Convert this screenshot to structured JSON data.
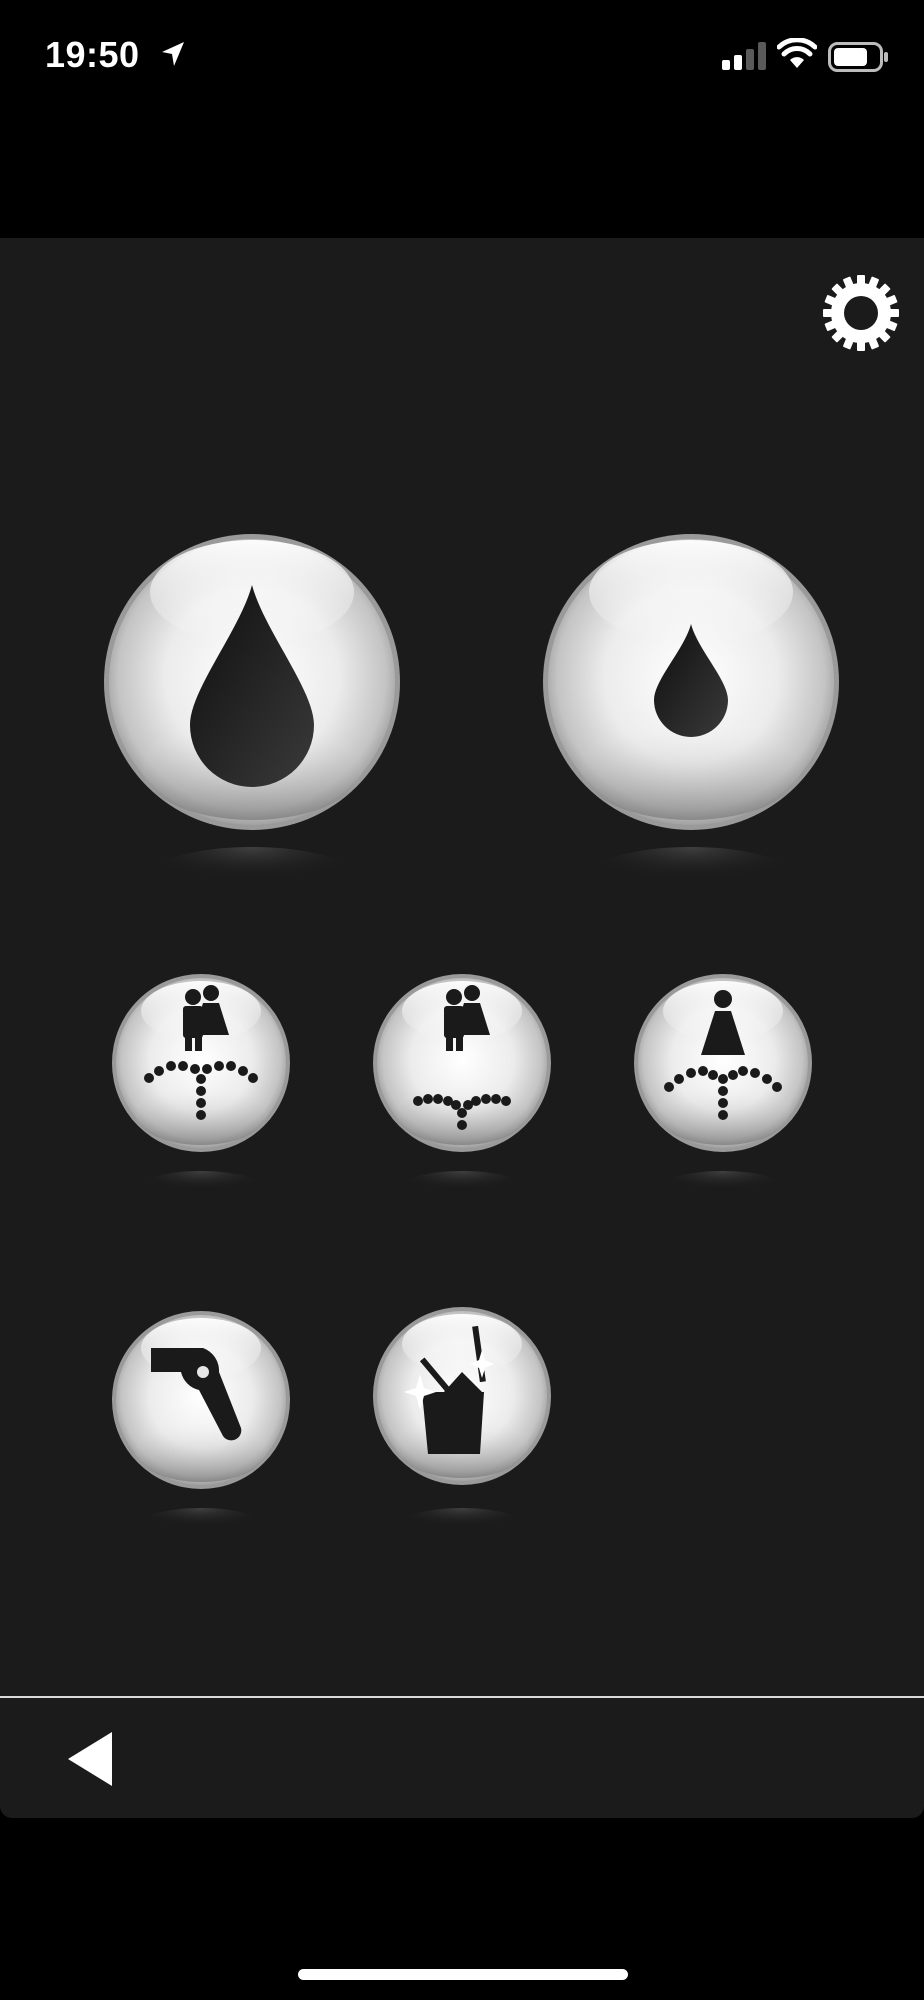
{
  "status_bar": {
    "time": "19:50",
    "location_icon": "location-arrow-icon",
    "signal_icon": "cellular-signal-icon",
    "wifi_icon": "wifi-icon",
    "battery_icon": "battery-icon"
  },
  "toolbar": {
    "settings_icon": "gear-icon"
  },
  "buttons": {
    "large": [
      {
        "icon": "large-water-drop-icon"
      },
      {
        "icon": "small-water-drop-icon"
      }
    ],
    "medium_row1": [
      {
        "icon": "couple-rear-spray-icon"
      },
      {
        "icon": "couple-wide-spray-icon"
      },
      {
        "icon": "lady-spray-icon"
      }
    ],
    "medium_row2": [
      {
        "icon": "dryer-icon"
      },
      {
        "icon": "nozzle-clean-icon"
      }
    ]
  },
  "bottom_bar": {
    "back_icon": "back-triangle-icon"
  },
  "colors": {
    "background": "#000000",
    "panel": "#1b1b1b",
    "icon_dark": "#1a1a1a",
    "sphere_light": "#ffffff",
    "sphere_mid": "#bdbdbd"
  }
}
